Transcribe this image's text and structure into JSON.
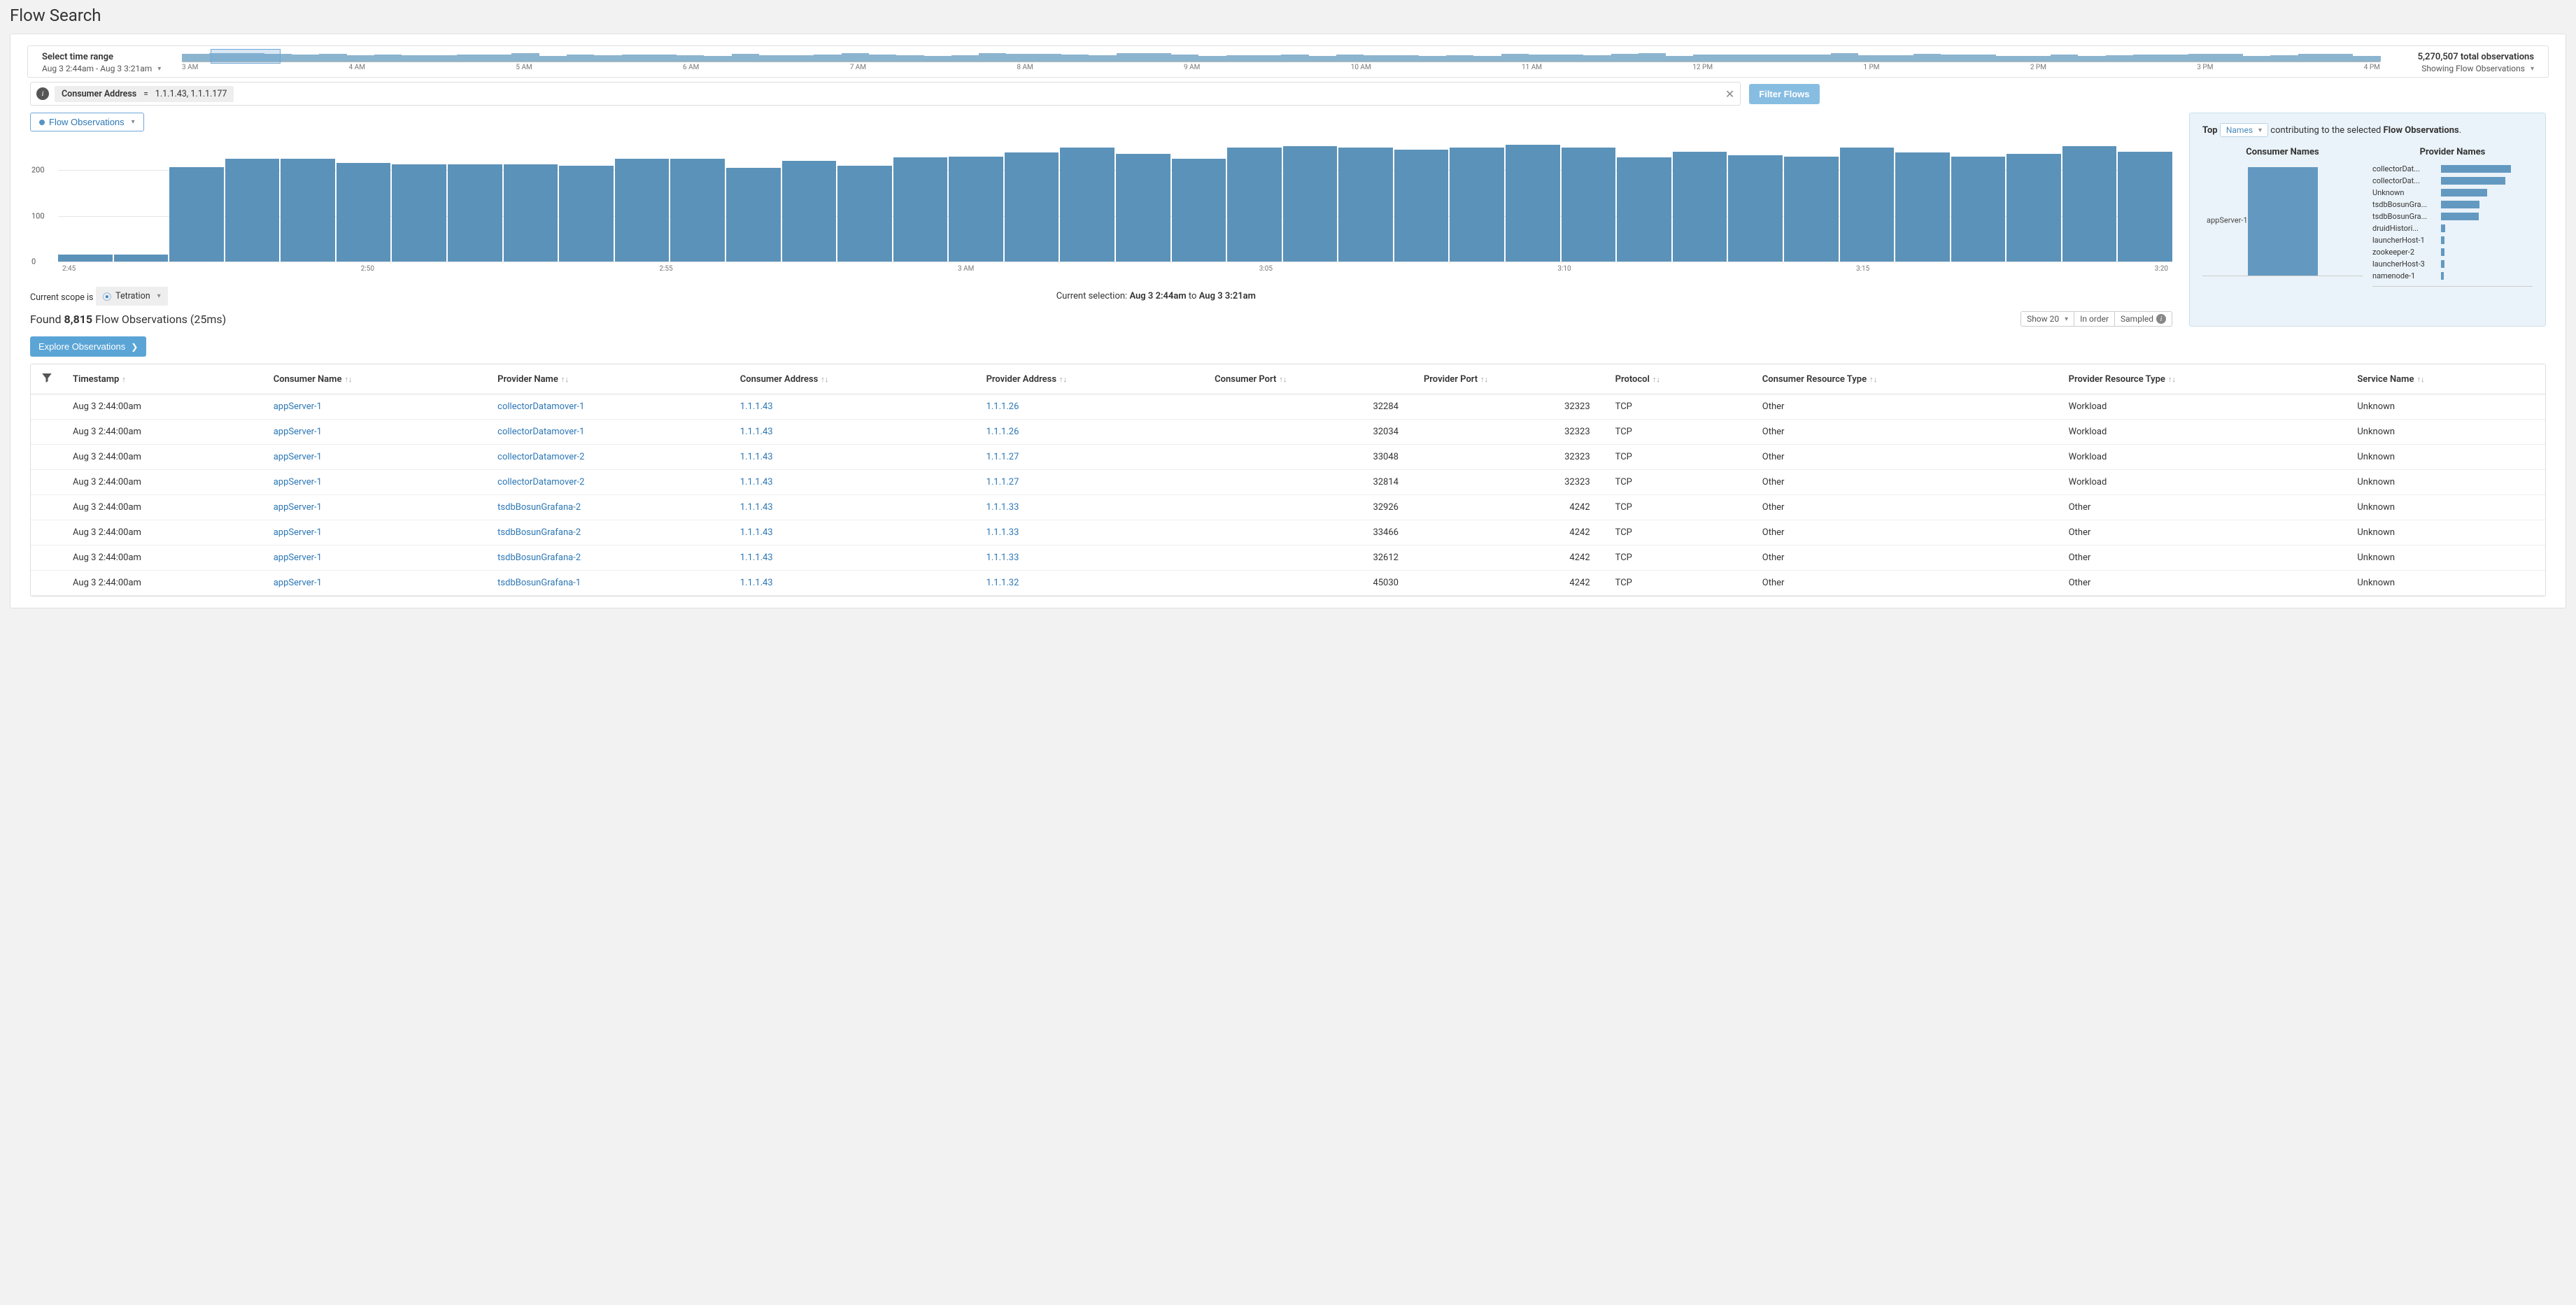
{
  "page_title": "Flow Search",
  "time_range": {
    "title": "Select time range",
    "range_text": "Aug 3 2:44am - Aug 3 3:21am",
    "total_observations": "5,270,507 total observations",
    "showing_text": "Showing Flow Observations",
    "ticks": [
      "3 AM",
      "4 AM",
      "5 AM",
      "6 AM",
      "7 AM",
      "8 AM",
      "9 AM",
      "10 AM",
      "11 AM",
      "12 PM",
      "1 PM",
      "2 PM",
      "3 PM",
      "4 PM"
    ]
  },
  "filter": {
    "key": "Consumer Address",
    "op": "=",
    "value": "1.1.1.43, 1.1.1.177",
    "button": "Filter Flows"
  },
  "flows_btn": "Flow Observations",
  "selection": {
    "scope_label": "Current scope is",
    "scope_value": "Tetration",
    "current_sel_prefix": "Current selection:",
    "from": "Aug 3 2:44am",
    "to_word": "to",
    "to": "Aug 3 3:21am"
  },
  "found": {
    "count": "8,815",
    "suffix": " Flow Observations (25ms)",
    "prefix": "Found ",
    "show": "Show 20",
    "order": "In order",
    "sampled": "Sampled"
  },
  "side": {
    "top": "Top",
    "names": "Names",
    "mid": " contributing to the selected ",
    "tail": "Flow Observations",
    "consumer_title": "Consumer Names",
    "provider_title": "Provider Names",
    "consumer_label": "appServer-1"
  },
  "explore": "Explore Observations",
  "columns": [
    "Timestamp",
    "Consumer Name",
    "Provider Name",
    "Consumer Address",
    "Provider Address",
    "Consumer Port",
    "Provider Port",
    "Protocol",
    "Consumer Resource Type",
    "Provider Resource Type",
    "Service Name"
  ],
  "chart_data": {
    "flow_timeline": {
      "type": "bar",
      "title": "Flow Observations",
      "ylabel": "",
      "ylim": [
        0,
        260
      ],
      "y_ticks": [
        0,
        100,
        200
      ],
      "x_ticks": [
        "2:45",
        "2:50",
        "2:55",
        "3 AM",
        "3:05",
        "3:10",
        "3:15",
        "3:20"
      ],
      "values": [
        15,
        15,
        206,
        225,
        225,
        215,
        213,
        213,
        212,
        210,
        225,
        225,
        205,
        220,
        210,
        228,
        230,
        238,
        250,
        235,
        225,
        250,
        253,
        250,
        245,
        250,
        255,
        250,
        228,
        240,
        232,
        230,
        250,
        238,
        230,
        235,
        252,
        240
      ]
    },
    "consumer_names": {
      "type": "bar",
      "categories": [
        "appServer-1"
      ],
      "values": [
        8815
      ]
    },
    "provider_names": {
      "type": "bar_h",
      "series": [
        {
          "name": "collectorDat...",
          "value": 100
        },
        {
          "name": "collectorDat...",
          "value": 92
        },
        {
          "name": "Unknown",
          "value": 66
        },
        {
          "name": "tsdbBosunGra...",
          "value": 55
        },
        {
          "name": "tsdbBosunGra...",
          "value": 54
        },
        {
          "name": "druidHistori...",
          "value": 6
        },
        {
          "name": "launcherHost-1",
          "value": 5
        },
        {
          "name": "zookeeper-2",
          "value": 5
        },
        {
          "name": "launcherHost-3",
          "value": 5
        },
        {
          "name": "namenode-1",
          "value": 4
        }
      ]
    }
  },
  "rows": [
    {
      "ts": "Aug 3 2:44:00am",
      "cn": "appServer-1",
      "pn": "collectorDatamover-1",
      "ca": "1.1.1.43",
      "pa": "1.1.1.26",
      "cp": "32284",
      "pp": "32323",
      "proto": "TCP",
      "crt": "Other",
      "prt": "Workload",
      "sn": "Unknown"
    },
    {
      "ts": "Aug 3 2:44:00am",
      "cn": "appServer-1",
      "pn": "collectorDatamover-1",
      "ca": "1.1.1.43",
      "pa": "1.1.1.26",
      "cp": "32034",
      "pp": "32323",
      "proto": "TCP",
      "crt": "Other",
      "prt": "Workload",
      "sn": "Unknown"
    },
    {
      "ts": "Aug 3 2:44:00am",
      "cn": "appServer-1",
      "pn": "collectorDatamover-2",
      "ca": "1.1.1.43",
      "pa": "1.1.1.27",
      "cp": "33048",
      "pp": "32323",
      "proto": "TCP",
      "crt": "Other",
      "prt": "Workload",
      "sn": "Unknown"
    },
    {
      "ts": "Aug 3 2:44:00am",
      "cn": "appServer-1",
      "pn": "collectorDatamover-2",
      "ca": "1.1.1.43",
      "pa": "1.1.1.27",
      "cp": "32814",
      "pp": "32323",
      "proto": "TCP",
      "crt": "Other",
      "prt": "Workload",
      "sn": "Unknown"
    },
    {
      "ts": "Aug 3 2:44:00am",
      "cn": "appServer-1",
      "pn": "tsdbBosunGrafana-2",
      "ca": "1.1.1.43",
      "pa": "1.1.1.33",
      "cp": "32926",
      "pp": "4242",
      "proto": "TCP",
      "crt": "Other",
      "prt": "Other",
      "sn": "Unknown"
    },
    {
      "ts": "Aug 3 2:44:00am",
      "cn": "appServer-1",
      "pn": "tsdbBosunGrafana-2",
      "ca": "1.1.1.43",
      "pa": "1.1.1.33",
      "cp": "33466",
      "pp": "4242",
      "proto": "TCP",
      "crt": "Other",
      "prt": "Other",
      "sn": "Unknown"
    },
    {
      "ts": "Aug 3 2:44:00am",
      "cn": "appServer-1",
      "pn": "tsdbBosunGrafana-2",
      "ca": "1.1.1.43",
      "pa": "1.1.1.33",
      "cp": "32612",
      "pp": "4242",
      "proto": "TCP",
      "crt": "Other",
      "prt": "Other",
      "sn": "Unknown"
    },
    {
      "ts": "Aug 3 2:44:00am",
      "cn": "appServer-1",
      "pn": "tsdbBosunGrafana-1",
      "ca": "1.1.1.43",
      "pa": "1.1.1.32",
      "cp": "45030",
      "pp": "4242",
      "proto": "TCP",
      "crt": "Other",
      "prt": "Other",
      "sn": "Unknown"
    }
  ]
}
